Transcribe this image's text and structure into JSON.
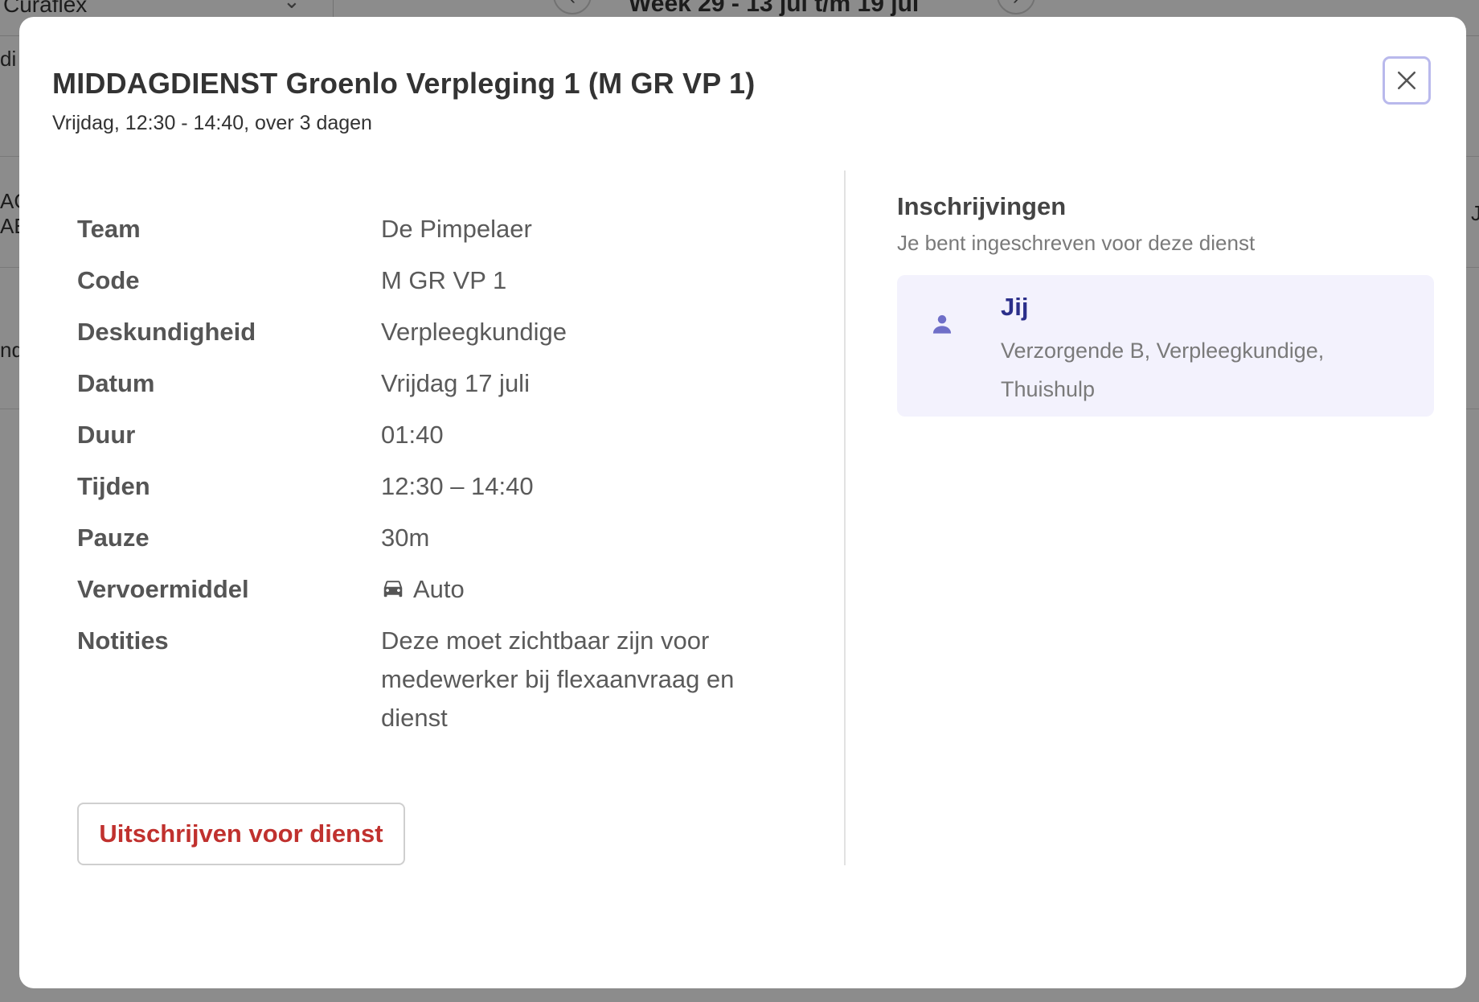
{
  "background": {
    "organization": "Curaflex",
    "week_label": "Week 29 - 13 jul t/m 19 jul",
    "fragments": [
      "di",
      "AG",
      "AE",
      "nd",
      "J"
    ]
  },
  "modal": {
    "title": "MIDDAGDIENST Groenlo Verpleging 1 (M GR VP 1)",
    "subtitle": "Vrijdag, 12:30 - 14:40, over 3 dagen",
    "close_label": "close",
    "details": [
      {
        "label": "Team",
        "value": "De Pimpelaer"
      },
      {
        "label": "Code",
        "value": "M GR VP 1"
      },
      {
        "label": "Deskundigheid",
        "value": "Verpleegkundige"
      },
      {
        "label": "Datum",
        "value": "Vrijdag 17 juli"
      },
      {
        "label": "Duur",
        "value": "01:40"
      },
      {
        "label": "Tijden",
        "value": "12:30 – 14:40"
      },
      {
        "label": "Pauze",
        "value": "30m"
      },
      {
        "label": "Vervoermiddel",
        "value": "Auto",
        "icon": "car-icon"
      },
      {
        "label": "Notities",
        "value": "Deze moet zichtbaar zijn voor medewerker bij flexaanvraag en dienst"
      }
    ],
    "unsubscribe_label": "Uitschrijven voor dienst",
    "enrollments": {
      "heading": "Inschrijvingen",
      "subheading": "Je bent ingeschreven voor deze dienst",
      "items": [
        {
          "name": "Jij",
          "roles": "Verzorgende B, Verpleegkundige, Thuishulp",
          "icon": "person-icon"
        }
      ]
    }
  },
  "colors": {
    "accent": "#2b2f8a",
    "danger": "#c0312e",
    "card_background": "#f3f2fd",
    "focus_ring": "#b9b9ec"
  }
}
